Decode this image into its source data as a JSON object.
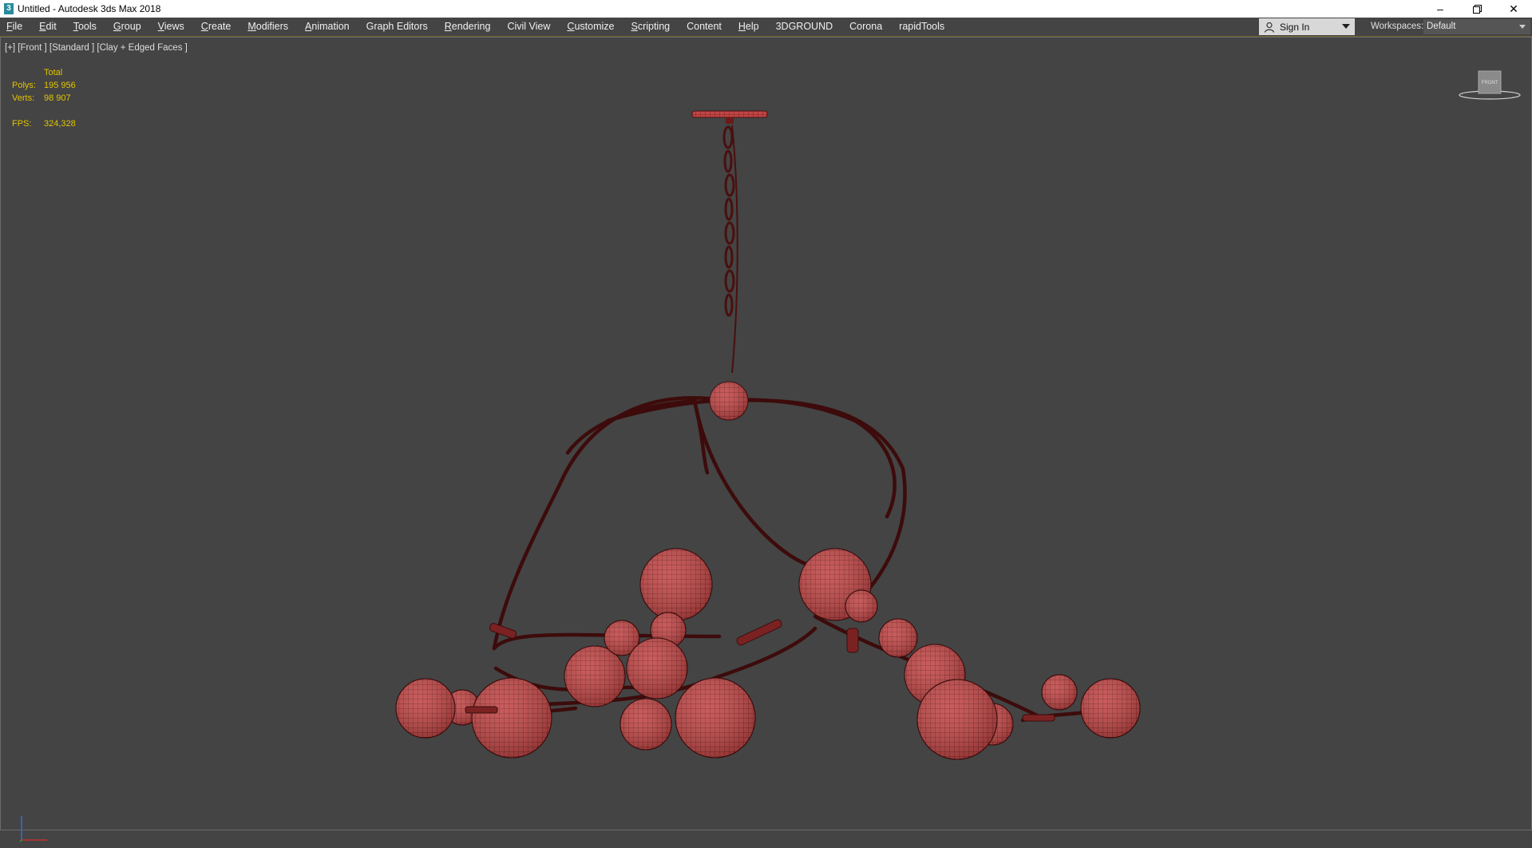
{
  "window": {
    "title": "Untitled - Autodesk 3ds Max 2018",
    "app_icon": "3ds-max-logo-icon",
    "controls": [
      "minimize-icon",
      "restore-icon",
      "close-icon"
    ]
  },
  "menu": [
    {
      "label": "File",
      "ul": "F",
      "rest": "ile"
    },
    {
      "label": "Edit",
      "ul": "E",
      "rest": "dit"
    },
    {
      "label": "Tools",
      "ul": "T",
      "rest": "ools"
    },
    {
      "label": "Group",
      "ul": "G",
      "rest": "roup"
    },
    {
      "label": "Views",
      "ul": "V",
      "rest": "iews"
    },
    {
      "label": "Create",
      "ul": "C",
      "rest": "reate"
    },
    {
      "label": "Modifiers",
      "ul": "M",
      "rest": "odifiers"
    },
    {
      "label": "Animation",
      "ul": "A",
      "rest": "nimation"
    },
    {
      "label": "Graph Editors",
      "ul": "",
      "rest": "Graph Editors"
    },
    {
      "label": "Rendering",
      "ul": "R",
      "rest": "endering"
    },
    {
      "label": "Civil View",
      "ul": "",
      "rest": "Civil View"
    },
    {
      "label": "Customize",
      "ul": "C",
      "rest": "ustomize"
    },
    {
      "label": "Scripting",
      "ul": "S",
      "rest": "cripting"
    },
    {
      "label": "Content",
      "ul": "",
      "rest": "Content"
    },
    {
      "label": "Help",
      "ul": "H",
      "rest": "elp"
    },
    {
      "label": "3DGROUND",
      "ul": "",
      "rest": "3DGROUND"
    },
    {
      "label": "Corona",
      "ul": "",
      "rest": "Corona"
    },
    {
      "label": "rapidTools",
      "ul": "",
      "rest": "rapidTools"
    }
  ],
  "account": {
    "signin_label": "Sign In",
    "icon": "user-icon"
  },
  "workspaces": {
    "label": "Workspaces:",
    "value": "Default"
  },
  "viewport": {
    "label": "[+] [Front ] [Standard ] [Clay + Edged Faces ]",
    "stats": {
      "header": "Total",
      "polys_label": "Polys:",
      "polys_value": "195 956",
      "verts_label": "Verts:",
      "verts_value": "98 907",
      "fps_label": "FPS:",
      "fps_value": "324,328"
    },
    "viewcube_label": "FRONT",
    "object": "chandelier-model",
    "colors": {
      "background": "#444444",
      "model": "#c24242",
      "wire": "#5a1414",
      "stats": "#e3c300"
    }
  }
}
